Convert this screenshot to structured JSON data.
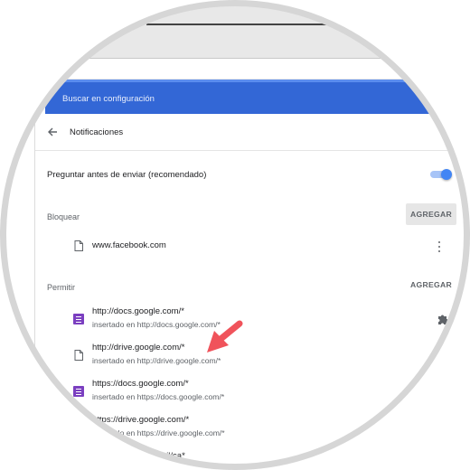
{
  "header": {
    "search_label": "Buscar en configuración"
  },
  "page": {
    "title": "Notificaciones",
    "ask_before_send_label": "Preguntar antes de enviar (recomendado)",
    "ask_before_send_enabled": true
  },
  "block": {
    "label": "Bloquear",
    "add_label": "AGREGAR",
    "items": [
      {
        "site": "www.facebook.com"
      }
    ]
  },
  "allow": {
    "label": "Permitir",
    "add_label": "AGREGAR",
    "items": [
      {
        "site": "http://docs.google.com/*",
        "detail": "insertado en http://docs.google.com/*",
        "icon": "docs-extension-icon"
      },
      {
        "site": "http://drive.google.com/*",
        "detail": "insertado en http://drive.google.com/*",
        "icon": "file-icon"
      },
      {
        "site": "https://docs.google.com/*",
        "detail": "insertado en https://docs.google.com/*",
        "icon": "docs-extension-icon"
      },
      {
        "site": "https://drive.google.com/*",
        "detail": "insertado en https://drive.google.com/*",
        "icon": "file-icon"
      },
      {
        "site": "mail/ca*"
      }
    ]
  },
  "colors": {
    "header_blue": "#3367d6",
    "toggle_blue": "#4285f4",
    "extension_purple": "#7b3fc0",
    "arrow_red": "#f0535b"
  }
}
